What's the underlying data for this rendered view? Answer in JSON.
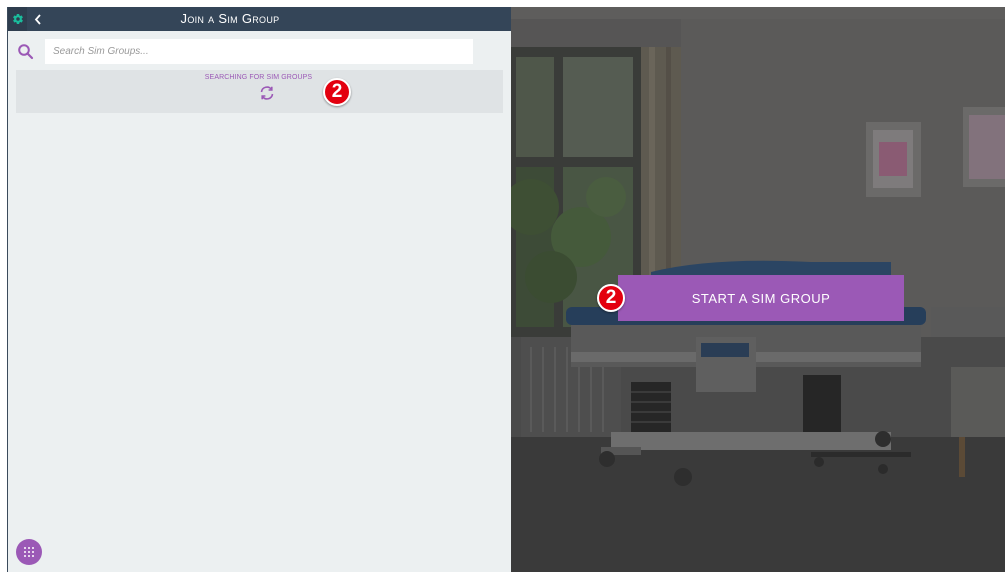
{
  "header": {
    "title": "Join a Sim Group",
    "settings_icon": "gear-icon",
    "back_icon": "chevron-left-icon"
  },
  "search": {
    "placeholder": "Search Sim Groups...",
    "value": "",
    "icon": "search-icon"
  },
  "status": {
    "text": "Searching for Sim Groups",
    "icon": "refresh-icon"
  },
  "badges": {
    "left": "2",
    "right": "2"
  },
  "actions": {
    "start_label": "START A SIM GROUP"
  },
  "footer": {
    "apps_icon": "apps-grid-icon"
  },
  "colors": {
    "header_bg": "#344558",
    "accent": "#9b59b6",
    "panel_bg": "#ecf0f1",
    "badge_red": "#e3000f"
  }
}
